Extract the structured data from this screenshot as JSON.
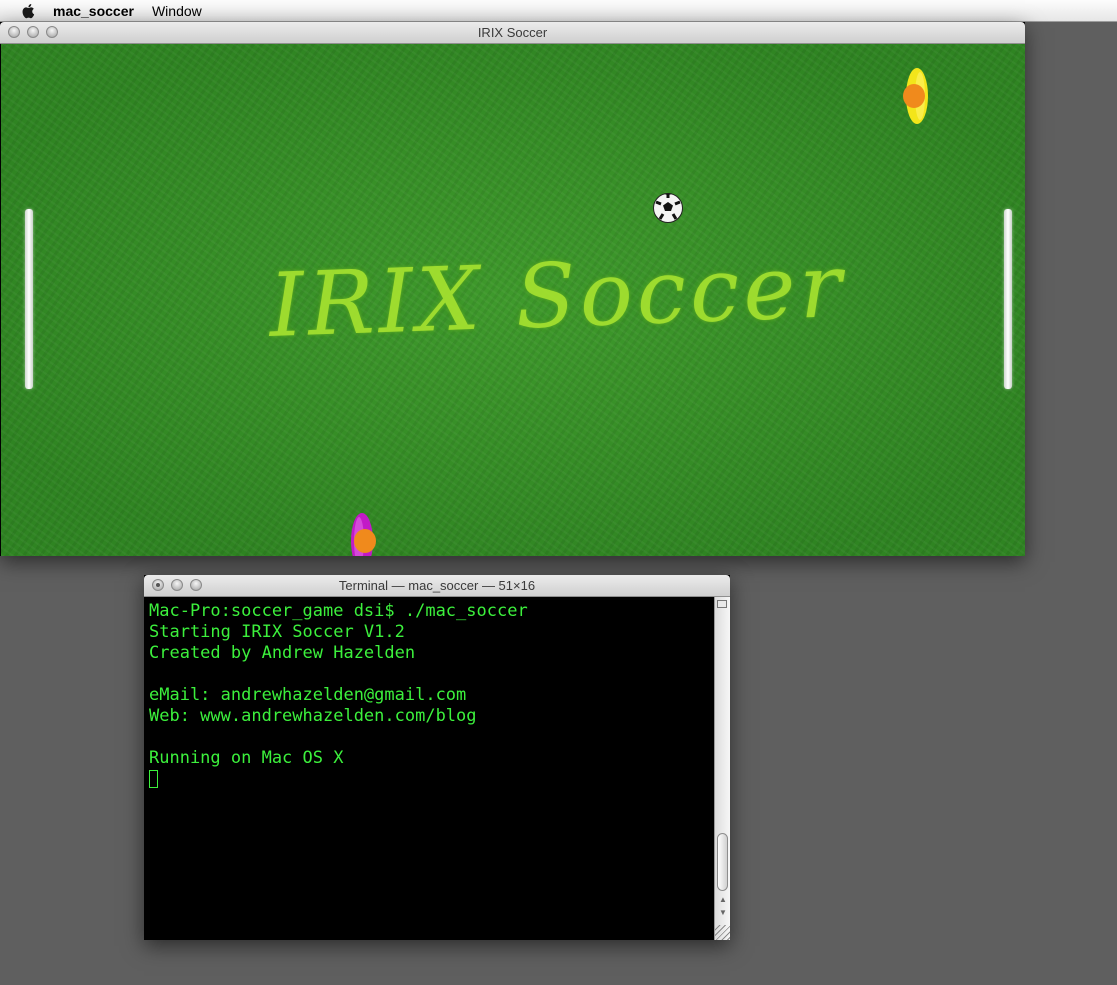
{
  "menubar": {
    "app_name": "mac_soccer",
    "items": [
      "Window"
    ]
  },
  "soccer_window": {
    "title": "IRIX Soccer",
    "field_title": "IRIX Soccer",
    "colors": {
      "grass": "#3a9228",
      "field_title": "#a8e42f",
      "player_top": "#f5e51b",
      "player_bottom": "#c41ac9",
      "player_head": "#f08a1c"
    }
  },
  "terminal_window": {
    "title": "Terminal — mac_soccer — 51×16",
    "lines": [
      "Mac-Pro:soccer_game dsi$ ./mac_soccer",
      "Starting IRIX Soccer V1.2",
      "Created by Andrew Hazelden",
      "",
      "eMail: andrewhazelden@gmail.com",
      "Web: www.andrewhazelden.com/blog",
      "",
      "Running on Mac OS X"
    ],
    "text_color": "#3cf03c"
  }
}
